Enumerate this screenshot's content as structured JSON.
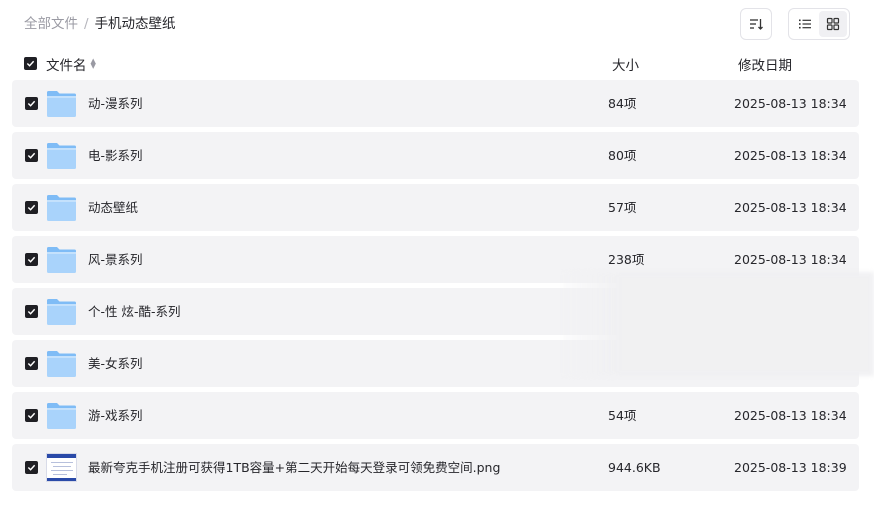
{
  "breadcrumb": {
    "root": "全部文件",
    "separator": "/",
    "current": "手机动态壁纸"
  },
  "toolbar": {
    "sort_icon": "sort-lines-icon",
    "list_view_icon": "list-view-icon",
    "grid_view_icon": "grid-view-icon",
    "active_view": "grid"
  },
  "columns": {
    "name": "文件名",
    "size": "大小",
    "date": "修改日期"
  },
  "files": [
    {
      "name": "动-漫系列",
      "size": "84项",
      "date": "2025-08-13 18:34",
      "type": "folder"
    },
    {
      "name": "电-影系列",
      "size": "80项",
      "date": "2025-08-13 18:34",
      "type": "folder"
    },
    {
      "name": "动态壁纸",
      "size": "57项",
      "date": "2025-08-13 18:34",
      "type": "folder"
    },
    {
      "name": "风-景系列",
      "size": "238项",
      "date": "2025-08-13 18:34",
      "type": "folder"
    },
    {
      "name": "个-性 炫-酷-系列",
      "size": "",
      "date": "",
      "type": "folder"
    },
    {
      "name": "美-女系列",
      "size": "",
      "date": "",
      "type": "folder"
    },
    {
      "name": "游-戏系列",
      "size": "54项",
      "date": "2025-08-13 18:34",
      "type": "folder"
    },
    {
      "name": "最新夸克手机注册可获得1TB容量+第二天开始每天登录可领免费空间.png",
      "size": "944.6KB",
      "date": "2025-08-13 18:39",
      "type": "image"
    }
  ],
  "colors": {
    "checkbox": "#1f1f24",
    "row_bg": "#f3f3f5",
    "folder_light": "#a9d3fb",
    "folder_dark": "#7fbcf6"
  }
}
